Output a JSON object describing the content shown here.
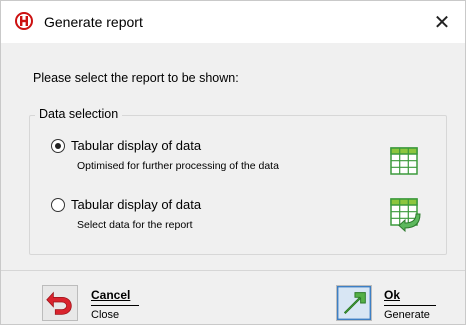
{
  "window": {
    "title": "Generate report",
    "close_glyph": "✕",
    "app_icon": "app-logo-icon"
  },
  "prompt": "Please select the report to be shown:",
  "group": {
    "legend": "Data selection"
  },
  "options": [
    {
      "title": "Tabular display of data",
      "description": "Optimised for further processing of the data",
      "selected": true,
      "icon": "table-grid-icon"
    },
    {
      "title": "Tabular display of  data",
      "description": "Select data for the report",
      "selected": false,
      "icon": "table-grid-arrow-icon"
    }
  ],
  "buttons": {
    "cancel": {
      "label": "Cancel",
      "sub": "Close",
      "icon": "undo-arrow-icon"
    },
    "ok": {
      "label": "Ok",
      "sub": "Generate",
      "icon": "green-arrow-icon"
    }
  },
  "colors": {
    "accent_red": "#cc1111",
    "grid_green": "#3c9a3c",
    "grid_header": "#8cc63f"
  }
}
